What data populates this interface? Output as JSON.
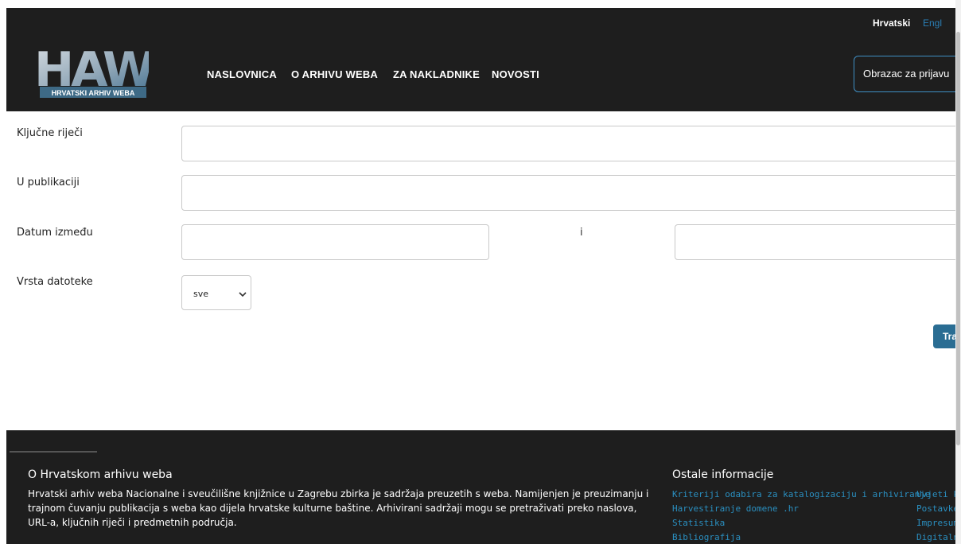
{
  "header": {
    "lang_hr": "Hrvatski",
    "lang_en": "Engl",
    "logo_text": "HAW",
    "logo_sub": "HRVATSKI ARHIV WEBA",
    "nav": [
      "NASLOVNICA",
      "O ARHIVU WEBA",
      "ZA NAKLADNIKE",
      "NOVOSTI"
    ],
    "signup_button": "Obrazac za prijavu"
  },
  "form": {
    "keywords_label": "Ključne riječi",
    "keywords_value": "",
    "publication_label": "U publikaciji",
    "publication_value": "",
    "date_label": "Datum između",
    "date_from": "",
    "date_and": "i",
    "date_to": "",
    "filetype_label": "Vrsta datoteke",
    "filetype_selected": "sve",
    "search_button": "Traž"
  },
  "footer": {
    "about_title": "O Hrvatskom arhivu weba",
    "about_text": "Hrvatski arhiv weba Nacionalne i sveučilišne knjižnice u Zagrebu zbirka je sadržaja preuzetih s weba. Namijenjen je preuzimanju i trajnom čuvanju publikacija s weba kao dijela hrvatske kulturne baštine. Arhivirani sadržaji mogu se pretraživati preko naslova, URL-a, ključnih riječi i predmetnih područja.",
    "other_title": "Ostale informacije",
    "links_col1": [
      "Kriteriji odabira za katalogizaciju i arhiviranje",
      "Harvestiranje domene .hr",
      "Statistika",
      "Bibliografija"
    ],
    "links_col2": [
      "Uvjeti ko",
      "Postavke",
      "Impresum",
      "Digitalne"
    ]
  },
  "colors": {
    "header_bg": "#1e1e1e",
    "link_blue": "#2a8fc0",
    "button_blue": "#2a6d93"
  }
}
